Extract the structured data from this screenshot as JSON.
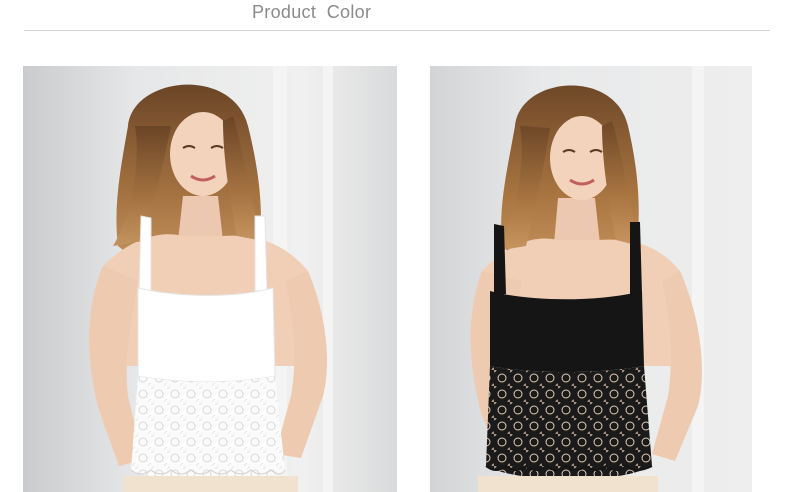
{
  "header": {
    "title": "Product  Color"
  },
  "colors": {
    "title_text": "#8a8a8a",
    "divider": "#d4d4d4",
    "white_variant": "#ffffff",
    "black_variant": "#151515"
  },
  "photos": [
    {
      "name": "white-lace-camisole-photo",
      "variant": "white"
    },
    {
      "name": "black-lace-camisole-photo",
      "variant": "black"
    }
  ]
}
